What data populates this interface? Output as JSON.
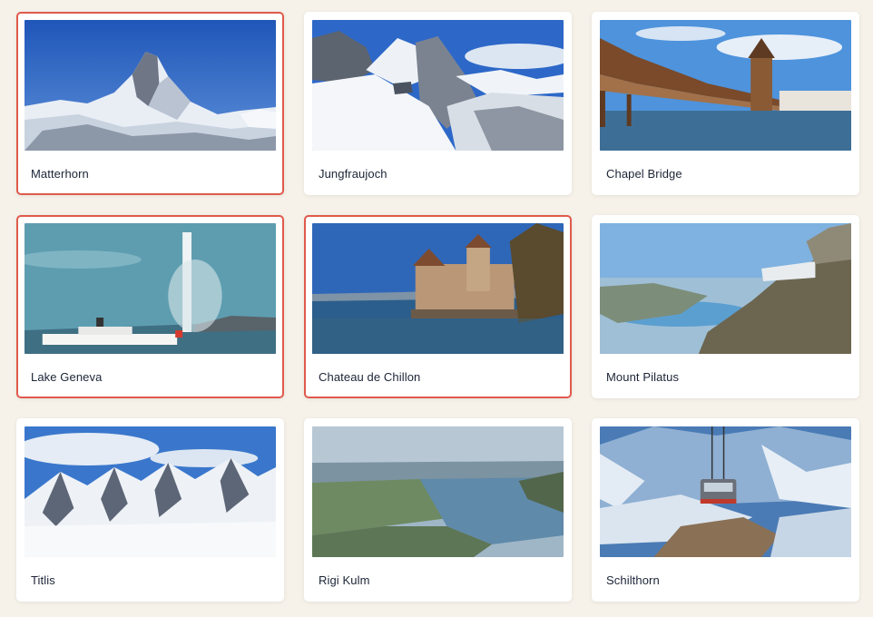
{
  "gallery": {
    "items": [
      {
        "title": "Matterhorn",
        "selected": true
      },
      {
        "title": "Jungfraujoch",
        "selected": false
      },
      {
        "title": "Chapel Bridge",
        "selected": false
      },
      {
        "title": "Lake Geneva",
        "selected": true
      },
      {
        "title": "Chateau de Chillon",
        "selected": true
      },
      {
        "title": "Mount Pilatus",
        "selected": false
      },
      {
        "title": "Titlis",
        "selected": false
      },
      {
        "title": "Rigi Kulm",
        "selected": false
      },
      {
        "title": "Schilthorn",
        "selected": false
      }
    ]
  },
  "colors": {
    "background": "#f6f2ea",
    "card": "#ffffff",
    "selected_border": "#e05a4c",
    "text": "#1b2436"
  }
}
